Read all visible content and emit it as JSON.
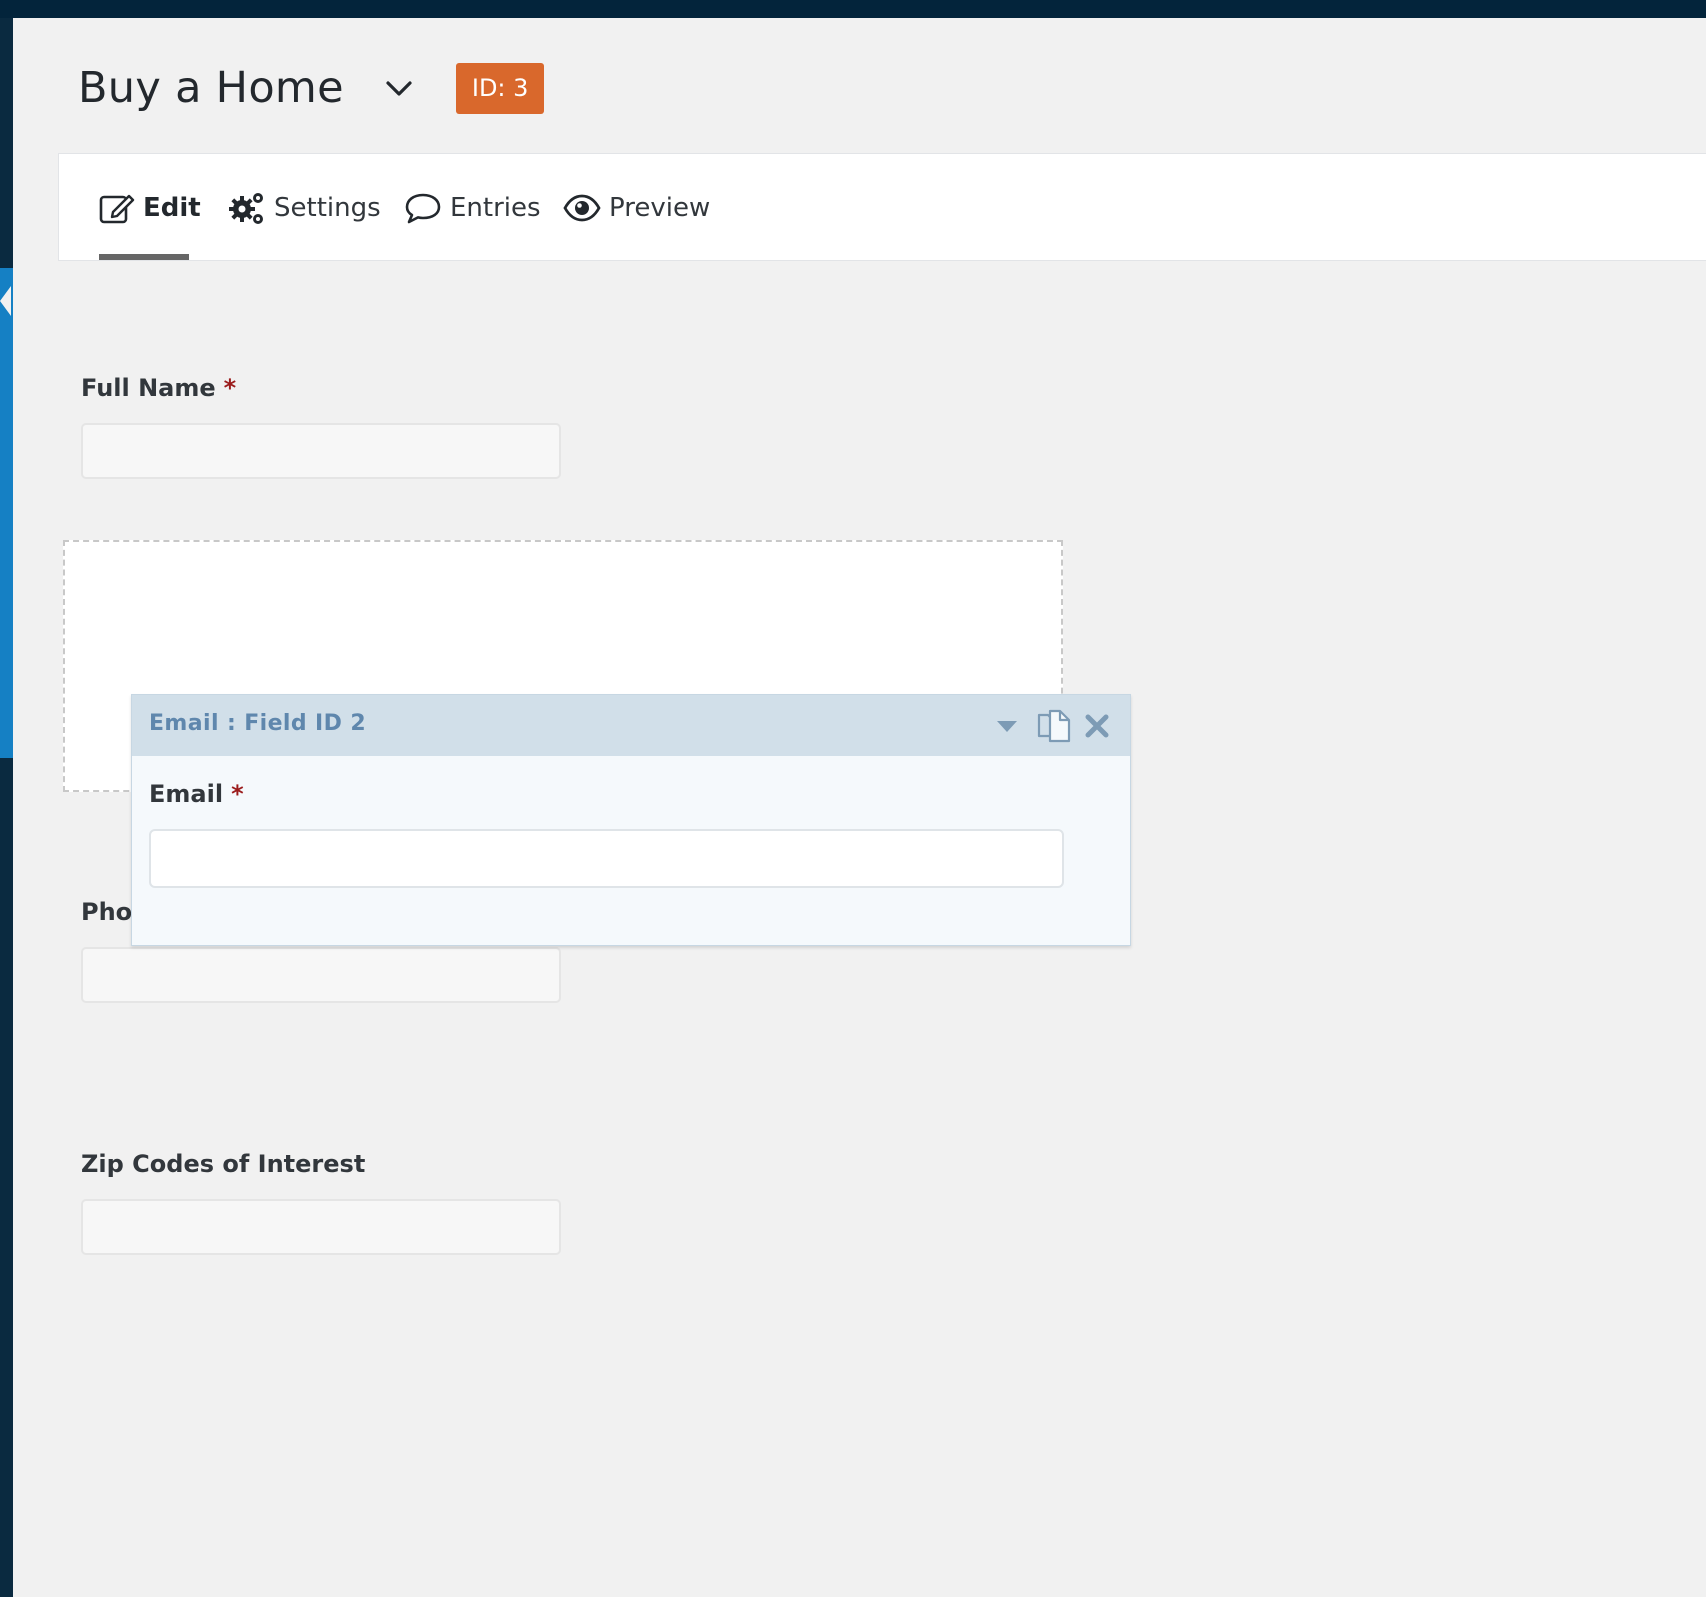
{
  "form": {
    "title": "Buy a Home",
    "id_badge": "ID: 3"
  },
  "tabs": [
    {
      "label": "Edit",
      "icon": "edit-icon",
      "active": true
    },
    {
      "label": "Settings",
      "icon": "gears-icon",
      "active": false
    },
    {
      "label": "Entries",
      "icon": "speech-bubble-icon",
      "active": false
    },
    {
      "label": "Preview",
      "icon": "eye-icon",
      "active": false
    }
  ],
  "fields": {
    "full_name": {
      "label": "Full Name",
      "required": "*"
    },
    "phone": {
      "label": "Pho"
    },
    "zip_codes": {
      "label": "Zip Codes of Interest"
    }
  },
  "dragged_field": {
    "header": "Email : Field ID 2",
    "label": "Email",
    "required": "*"
  },
  "colors": {
    "admin_bar": "#03243b",
    "sidebar_active": "#1580c4",
    "badge": "#d9682c",
    "field_header": "#d1dfe9",
    "field_header_text": "#5f87ad",
    "required_star": "#9b1c1c"
  }
}
